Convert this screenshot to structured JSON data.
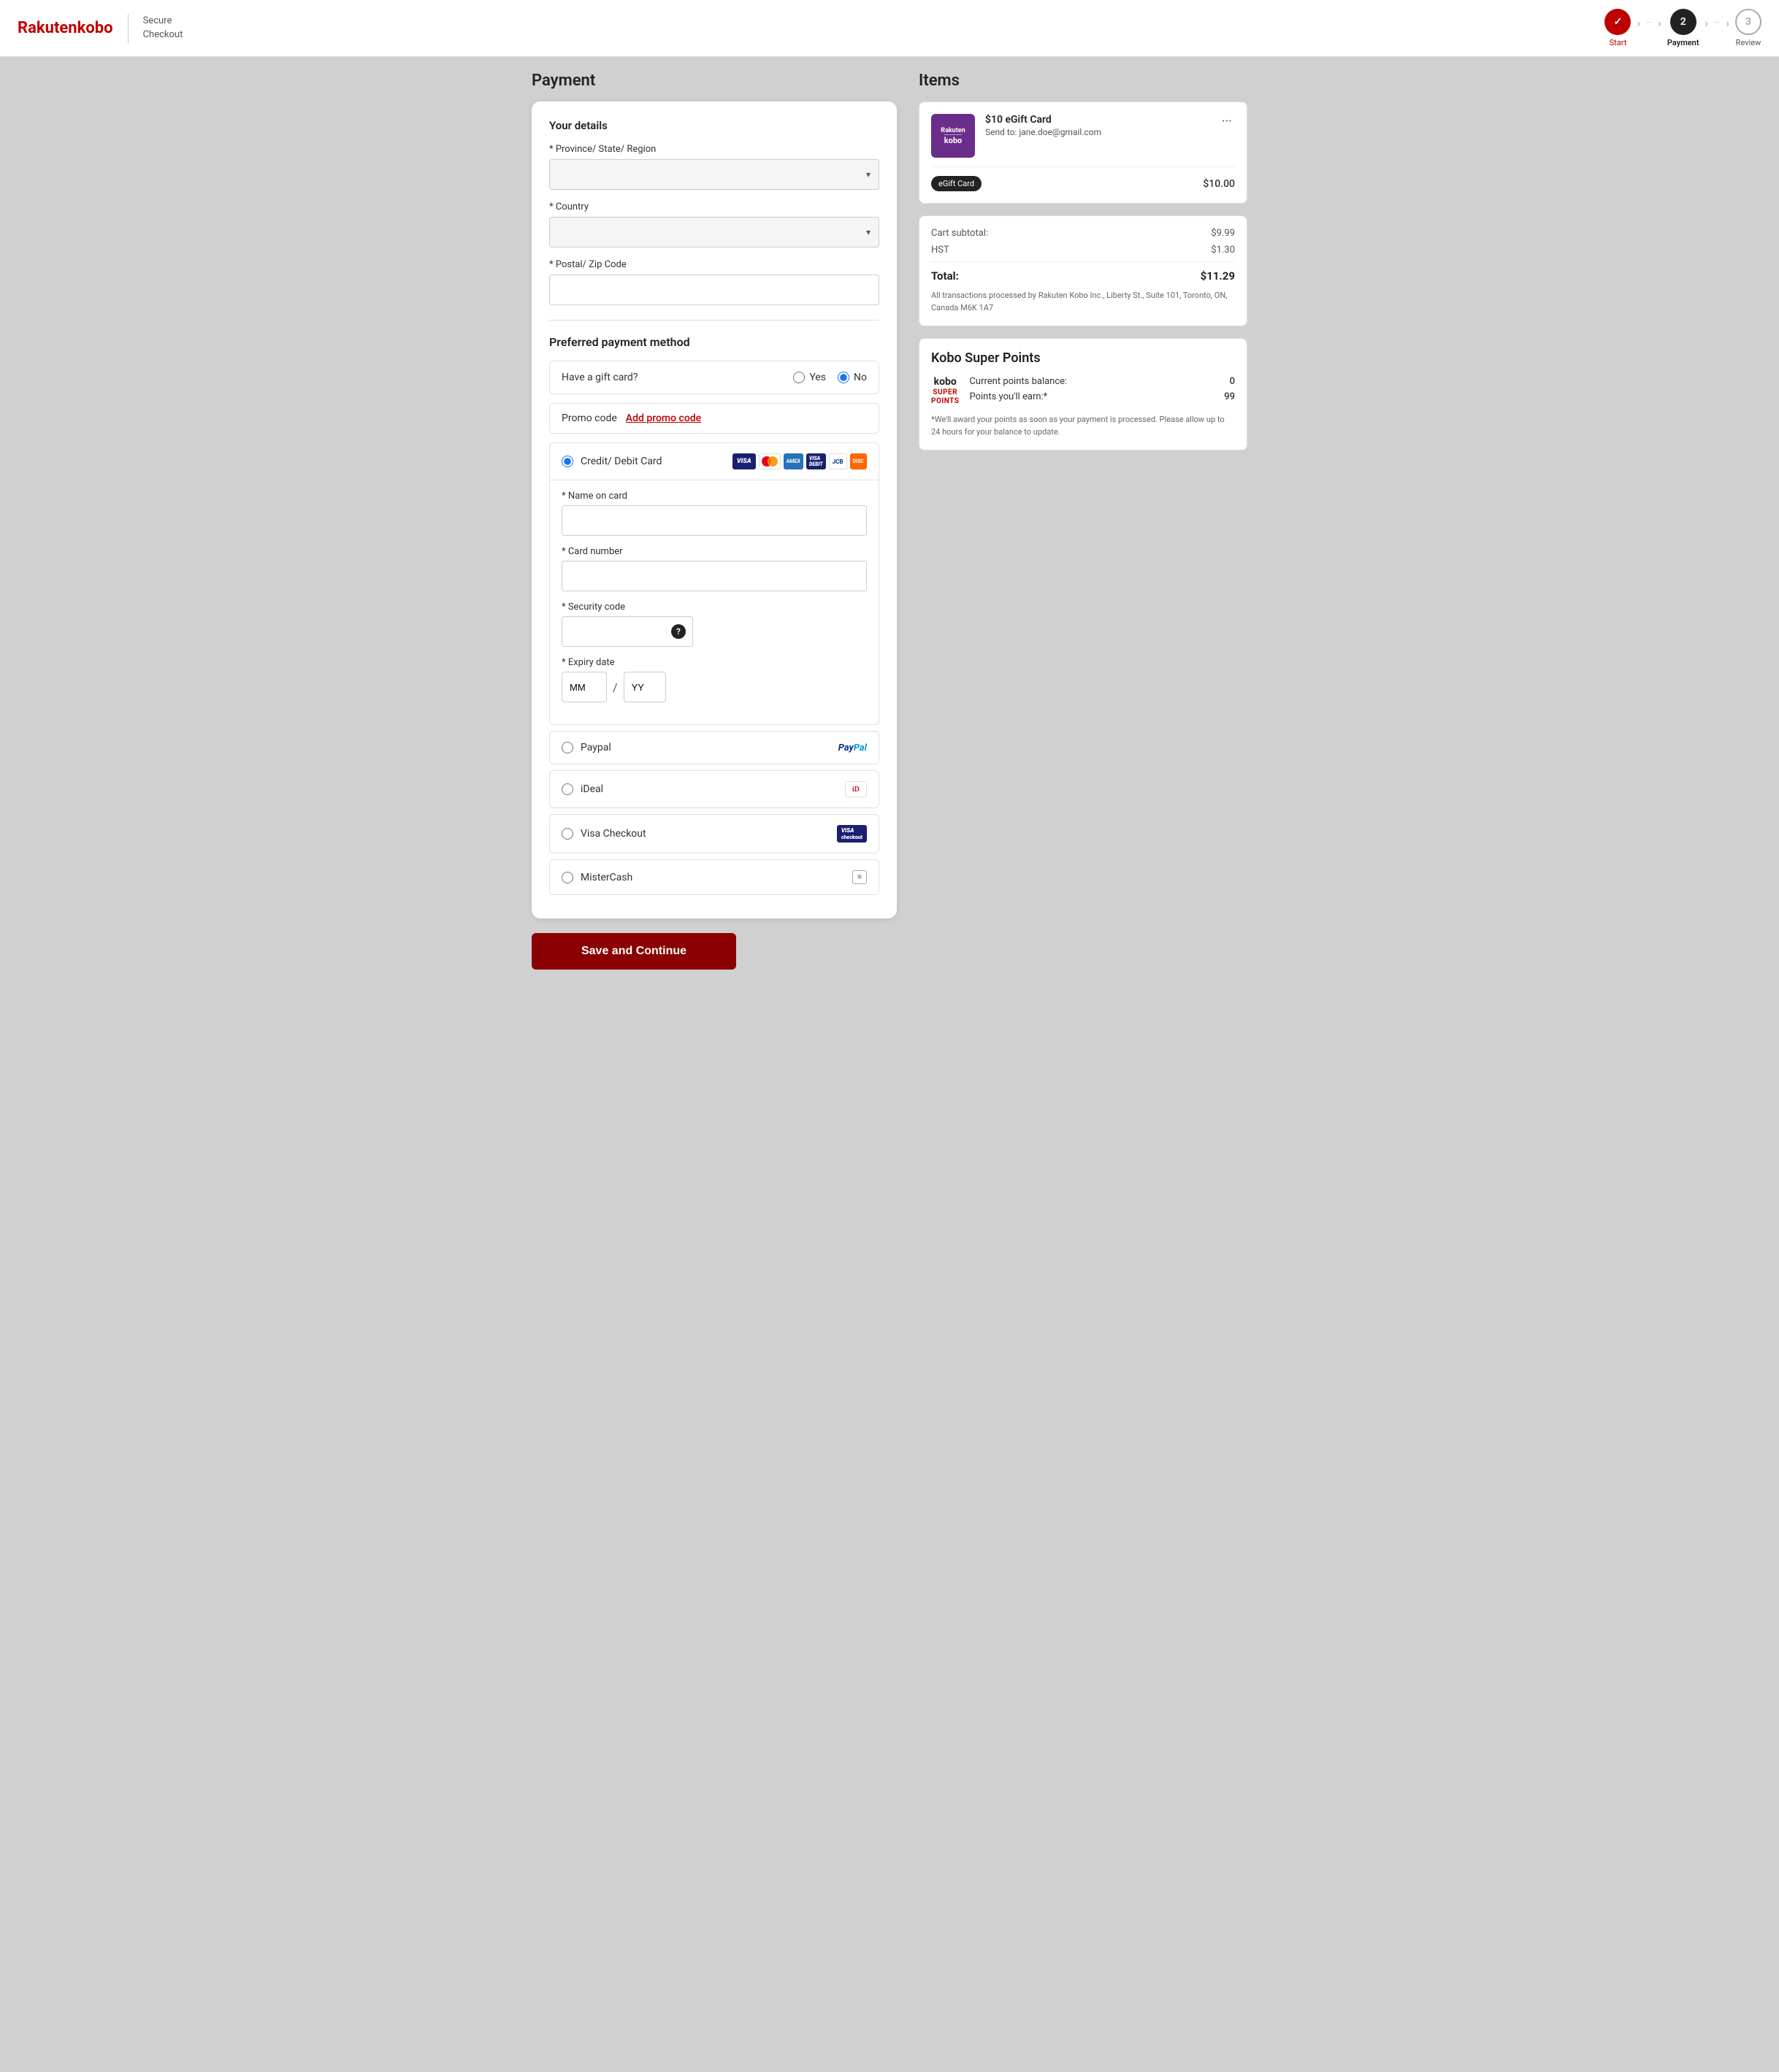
{
  "header": {
    "logo_rakuten": "Rakuten",
    "logo_kobo": "kobo",
    "secure_checkout_line1": "Secure",
    "secure_checkout_line2": "Checkout"
  },
  "stepper": {
    "steps": [
      {
        "id": "start",
        "label": "Start",
        "state": "done",
        "number": "✓"
      },
      {
        "id": "payment",
        "label": "Payment",
        "state": "active",
        "number": "2"
      },
      {
        "id": "review",
        "label": "Review",
        "state": "inactive",
        "number": "3"
      }
    ]
  },
  "payment": {
    "page_title": "Payment",
    "your_details_title": "Your details",
    "province_label": "* Province/ State/ Region",
    "province_placeholder": "",
    "country_label": "* Country",
    "country_placeholder": "",
    "postal_label": "* Postal/ Zip Code",
    "postal_placeholder": "",
    "preferred_payment_title": "Preferred payment method",
    "gift_card_label": "Have a gift card?",
    "gift_card_yes": "Yes",
    "gift_card_no": "No",
    "promo_label": "Promo code",
    "promo_link": "Add promo code",
    "credit_card_label": "Credit/ Debit Card",
    "name_on_card_label": "* Name on card",
    "card_number_label": "* Card number",
    "security_code_label": "* Security code",
    "expiry_label": "* Expiry date",
    "mm_placeholder": "MM",
    "yy_placeholder": "YY",
    "paypal_label": "Paypal",
    "ideal_label": "iDeal",
    "visa_checkout_label": "Visa Checkout",
    "mistercash_label": "MisterCash",
    "save_btn": "Save and Continue"
  },
  "items": {
    "title": "Items",
    "item": {
      "thumb_rakuten": "Rakuten",
      "thumb_kobo": "kobo",
      "name": "$10 eGift Card",
      "send_to": "Send to: jane.doe@gmail.com",
      "type_badge": "eGift Card",
      "price": "$10.00"
    },
    "cart_subtotal_label": "Cart subtotal:",
    "cart_subtotal_value": "$9.99",
    "hst_label": "HST",
    "hst_value": "$1.30",
    "total_label": "Total:",
    "total_value": "$11.29",
    "transaction_notice": "All transactions processed by Rakuten Kobo Inc., Liberty St., Suite 101, Toronto, ON, Canada M6K 1A7"
  },
  "kobo_points": {
    "title": "Kobo Super Points",
    "logo_top": "kobo",
    "logo_mid": "SUPER",
    "logo_bot": "POINTS",
    "current_balance_label": "Current points balance:",
    "current_balance_value": "0",
    "points_earn_label": "Points you'll earn:*",
    "points_earn_value": "99",
    "note": "*We'll award your points as soon as your payment is processed. Please allow up to 24 hours for your balance to update."
  }
}
